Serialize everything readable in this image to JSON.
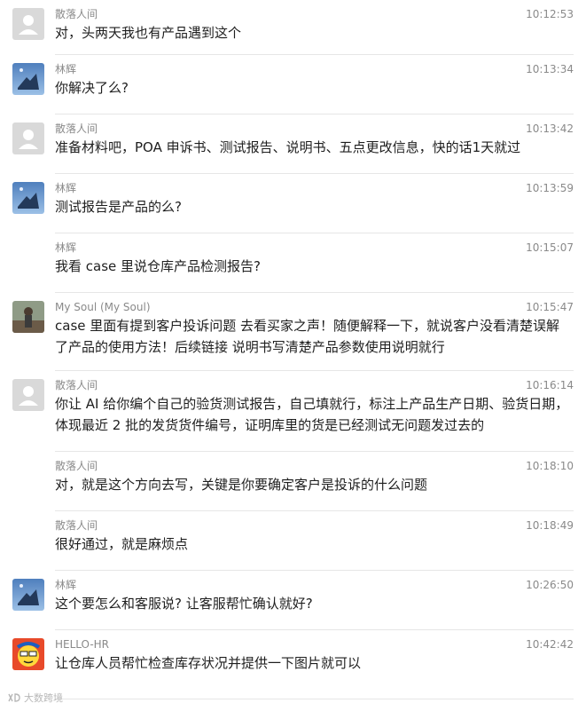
{
  "messages": [
    {
      "sender": "散落人间",
      "time": "10:12:53",
      "avatar": "default-avatar-icon",
      "text": "对，头两天我也有产品遇到这个"
    },
    {
      "sender": "林辉",
      "time": "10:13:34",
      "avatar": "night-sky-avatar",
      "text": "你解决了么?"
    },
    {
      "sender": "散落人间",
      "time": "10:13:42",
      "avatar": "default-avatar-icon",
      "text": "准备材料吧，POA 申诉书、测试报告、说明书、五点更改信息，快的话1天就过"
    },
    {
      "sender": "林辉",
      "time": "10:13:59",
      "avatar": "night-sky-avatar",
      "text": "测试报告是产品的么?"
    },
    {
      "sender": "林辉",
      "time": "10:15:07",
      "avatar": "none",
      "text": "我看 case 里说仓库产品检测报告?"
    },
    {
      "sender": "My Soul (My Soul)",
      "time": "10:15:47",
      "avatar": "person-photo-avatar",
      "text": "case 里面有提到客户投诉问题 去看买家之声！随便解释一下，就说客户没看清楚误解了产品的使用方法！后续链接 说明书写清楚产品参数使用说明就行"
    },
    {
      "sender": "散落人间",
      "time": "10:16:14",
      "avatar": "default-avatar-icon",
      "text": "你让 AI 给你编个自己的验货测试报告，自己填就行，标注上产品生产日期、验货日期，体现最近 2 批的发货货件编号，证明库里的货是已经测试无问题发过去的"
    },
    {
      "sender": "散落人间",
      "time": "10:18:10",
      "avatar": "none",
      "text": "对，就是这个方向去写，关键是你要确定客户是投诉的什么问题"
    },
    {
      "sender": "散落人间",
      "time": "10:18:49",
      "avatar": "none",
      "text": "很好通过，就是麻烦点"
    },
    {
      "sender": "林辉",
      "time": "10:26:50",
      "avatar": "night-sky-avatar",
      "text": "这个要怎么和客服说? 让客服帮忙确认就好?"
    },
    {
      "sender": "HELLO-HR",
      "time": "10:42:42",
      "avatar": "cartoon-avatar",
      "text": "让仓库人员帮忙检查库存状况并提供一下图片就可以"
    }
  ],
  "watermark": {
    "text": "大数跨境",
    "icon": "logo-mark-icon"
  },
  "colors": {
    "text": "#1e1e1e",
    "meta": "#8a8a8a",
    "divider": "#e6e6e6",
    "default_avatar_bg": "#d9d9d9"
  }
}
